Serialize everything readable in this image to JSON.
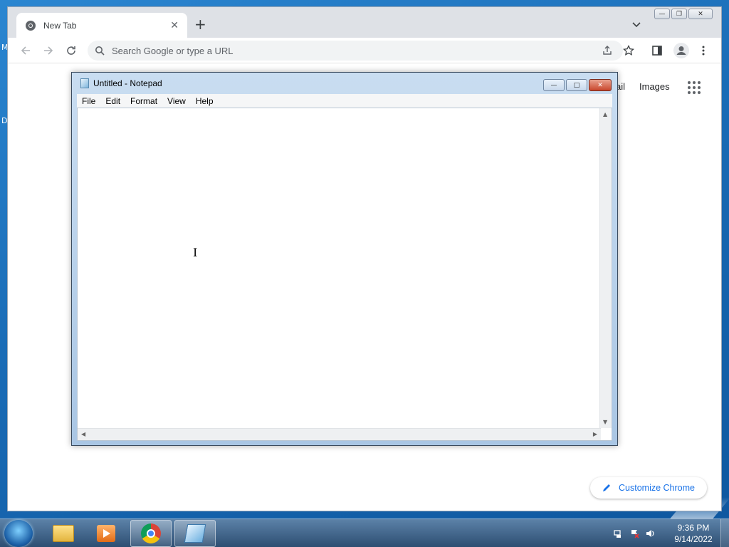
{
  "desktop": {
    "frag1": "M",
    "frag2": "D"
  },
  "chrome": {
    "tab": {
      "title": "New Tab",
      "close": "✕"
    },
    "new_tab": "+",
    "tab_search": "⌄",
    "omnibox": {
      "placeholder": "Search Google or type a URL"
    },
    "content": {
      "gmail": "ail",
      "images": "Images"
    },
    "customize": "Customize Chrome",
    "win": {
      "min": "—",
      "max": "❐",
      "close": "✕"
    }
  },
  "notepad": {
    "title": "Untitled - Notepad",
    "menu": [
      "File",
      "Edit",
      "Format",
      "View",
      "Help"
    ],
    "btns": {
      "min": "—",
      "max": "□",
      "close": "✕"
    }
  },
  "taskbar": {
    "clock_time": "9:36 PM",
    "clock_date": "9/14/2022"
  },
  "icons": [
    "chrome-logo-icon",
    "back-icon",
    "forward-icon",
    "reload-icon",
    "search-icon",
    "share-icon",
    "star-icon",
    "sidepanel-icon",
    "profile-icon",
    "menu-icon",
    "apps-icon",
    "pencil-icon",
    "notepad-icon",
    "start-orb-icon",
    "folder-icon",
    "media-player-icon",
    "chrome-taskbar-icon",
    "notepad-taskbar-icon",
    "network-icon",
    "flag-icon",
    "volume-icon"
  ]
}
